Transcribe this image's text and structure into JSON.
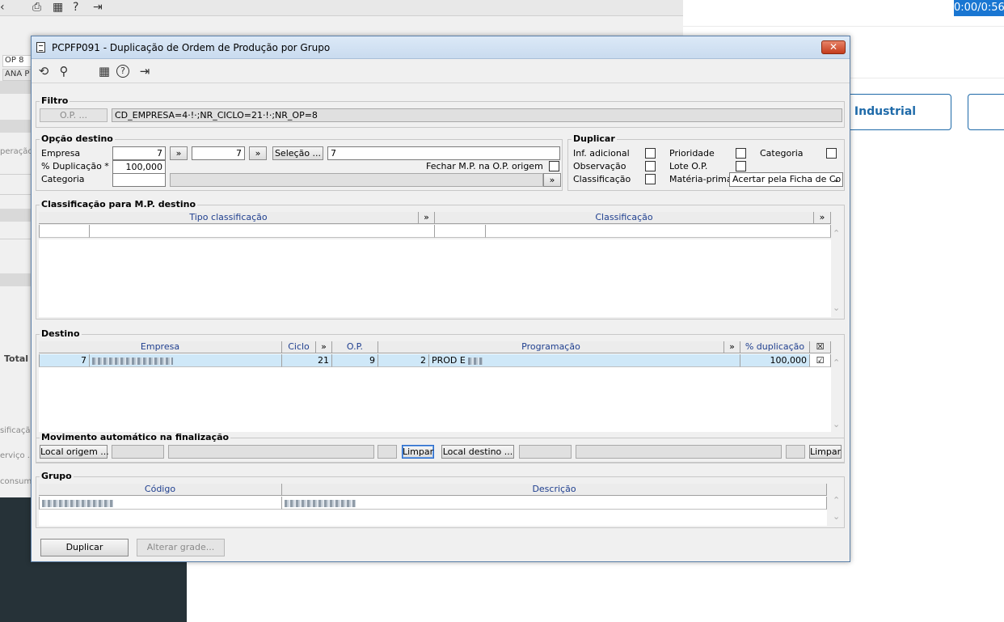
{
  "background": {
    "left_fields": [
      "OP 8",
      "ANA P"
    ],
    "left_texts": [
      "peração",
      "Total",
      "sificaçã",
      "erviço ...",
      "consum"
    ],
    "timer": "0:00/0:56",
    "industrial_label": "Industrial"
  },
  "dialog": {
    "title": "PCPFP091 - Duplicação de Ordem de Produção por Grupo",
    "close_label": "✕",
    "toolbar": {
      "undo_icon": "⟲",
      "search_icon": "⚲",
      "calendar_icon": "▦",
      "help_icon": "?",
      "exit_icon": "⇥"
    },
    "filtro": {
      "label": "Filtro",
      "op_button": "O.P. ...",
      "value": "CD_EMPRESA=4·!·;NR_CICLO=21·!·;NR_OP=8"
    },
    "opcao_destino": {
      "label": "Opção destino",
      "empresa_label": "Empresa",
      "empresa_value1": "7",
      "empresa_value2": "7",
      "arrow_label": "»",
      "selecao_button": "Seleção ...",
      "selecao_value": "7",
      "dup_label": "% Duplicação *",
      "dup_value": "100,000",
      "fechar_label": "Fechar M.P. na O.P. origem",
      "categoria_label": "Categoria",
      "categoria_value": "",
      "categoria_desc": ""
    },
    "duplicar": {
      "label": "Duplicar",
      "inf_adicional": "Inf. adicional",
      "observacao": "Observação",
      "classificacao": "Classificação",
      "prioridade": "Prioridade",
      "lote_op": "Lote O.P.",
      "materia_prima": "Matéria-prima",
      "materia_prima_value": "Acertar pela Ficha de Co",
      "categoria": "Categoria"
    },
    "classificacao_mp": {
      "label": "Classificação para M.P. destino",
      "col_tipo": "Tipo classificação",
      "col_class": "Classificação",
      "arrow": "»"
    },
    "destino": {
      "label": "Destino",
      "columns": [
        "Empresa",
        "Ciclo",
        "O.P.",
        "Programação",
        "% duplicação"
      ],
      "arrow": "»",
      "rows": [
        {
          "empresa": "7",
          "ciclo": "21",
          "op": "9",
          "programacao_num": "2",
          "programacao_desc": "PROD E",
          "dup": "100,000",
          "checked": true
        }
      ]
    },
    "movimento": {
      "label": "Movimento automático na finalização",
      "local_origem": "Local origem ...",
      "limpar1": "Limpar",
      "local_destino": "Local destino ...",
      "limpar2": "Limpar"
    },
    "grupo": {
      "label": "Grupo",
      "col_codigo": "Código",
      "col_descricao": "Descrição"
    },
    "footer": {
      "duplicar_btn": "Duplicar",
      "alterar_btn": "Alterar grade..."
    }
  }
}
